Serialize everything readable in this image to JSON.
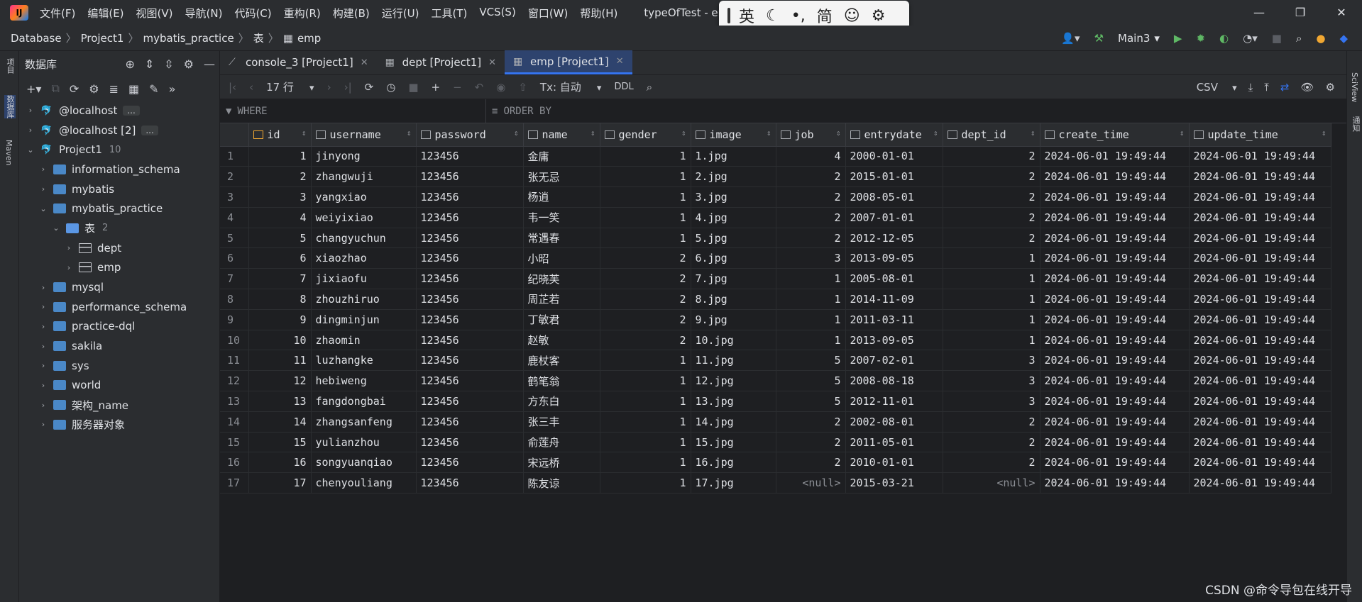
{
  "app": {
    "menu": [
      "文件(F)",
      "编辑(E)",
      "视图(V)",
      "导航(N)",
      "代码(C)",
      "重构(R)",
      "构建(B)",
      "运行(U)",
      "工具(T)",
      "VCS(S)",
      "窗口(W)",
      "帮助(H)"
    ],
    "title": "typeOfTest - emp [P"
  },
  "ime": {
    "lang": "英",
    "punct": "•,",
    "mode": "简"
  },
  "breadcrumb": [
    "Database",
    "Project1",
    "mybatis_practice",
    "表",
    "emp"
  ],
  "run_config": "Main3",
  "left_strip": [
    "项目",
    "数据库",
    "Maven"
  ],
  "right_strip": [
    "SciView",
    "通知"
  ],
  "db_panel": {
    "title": "数据库",
    "tree": [
      {
        "label": "@localhost",
        "level": 0,
        "chev": "›",
        "icon": "mysql",
        "dots": "..."
      },
      {
        "label": "@localhost [2]",
        "level": 0,
        "chev": "›",
        "icon": "mysql",
        "dots": "..."
      },
      {
        "label": "Project1",
        "level": 0,
        "chev": "⌄",
        "icon": "mysql",
        "badge": "10"
      },
      {
        "label": "information_schema",
        "level": 1,
        "chev": "›",
        "icon": "db"
      },
      {
        "label": "mybatis",
        "level": 1,
        "chev": "›",
        "icon": "db"
      },
      {
        "label": "mybatis_practice",
        "level": 1,
        "chev": "⌄",
        "icon": "db"
      },
      {
        "label": "表",
        "level": 2,
        "chev": "⌄",
        "icon": "folder",
        "badge": "2"
      },
      {
        "label": "dept",
        "level": 3,
        "chev": "›",
        "icon": "table"
      },
      {
        "label": "emp",
        "level": 3,
        "chev": "›",
        "icon": "table"
      },
      {
        "label": "mysql",
        "level": 1,
        "chev": "›",
        "icon": "db"
      },
      {
        "label": "performance_schema",
        "level": 1,
        "chev": "›",
        "icon": "db"
      },
      {
        "label": "practice-dql",
        "level": 1,
        "chev": "›",
        "icon": "db"
      },
      {
        "label": "sakila",
        "level": 1,
        "chev": "›",
        "icon": "db"
      },
      {
        "label": "sys",
        "level": 1,
        "chev": "›",
        "icon": "db"
      },
      {
        "label": "world",
        "level": 1,
        "chev": "›",
        "icon": "db"
      },
      {
        "label": "架构_name",
        "level": 1,
        "chev": "›",
        "icon": "db"
      },
      {
        "label": "服务器对象",
        "level": 1,
        "chev": "›",
        "icon": "db"
      }
    ]
  },
  "tabs": [
    {
      "label": "console_3 [Project1]",
      "active": false
    },
    {
      "label": "dept [Project1]",
      "active": false
    },
    {
      "label": "emp [Project1]",
      "active": true
    }
  ],
  "grid_toolbar": {
    "rows": "17 行",
    "tx": "Tx: 自动",
    "ddl": "DDL",
    "format": "CSV"
  },
  "filter": {
    "where": "WHERE",
    "order": "ORDER BY"
  },
  "table": {
    "columns": [
      "id",
      "username",
      "password",
      "name",
      "gender",
      "image",
      "job",
      "entrydate",
      "dept_id",
      "create_time",
      "update_time"
    ],
    "rows": [
      [
        "1",
        "1",
        "jinyong",
        "123456",
        "金庸",
        "1",
        "1.jpg",
        "4",
        "2000-01-01",
        "2",
        "2024-06-01 19:49:44",
        "2024-06-01 19:49:44"
      ],
      [
        "2",
        "2",
        "zhangwuji",
        "123456",
        "张无忌",
        "1",
        "2.jpg",
        "2",
        "2015-01-01",
        "2",
        "2024-06-01 19:49:44",
        "2024-06-01 19:49:44"
      ],
      [
        "3",
        "3",
        "yangxiao",
        "123456",
        "杨逍",
        "1",
        "3.jpg",
        "2",
        "2008-05-01",
        "2",
        "2024-06-01 19:49:44",
        "2024-06-01 19:49:44"
      ],
      [
        "4",
        "4",
        "weiyixiao",
        "123456",
        "韦一笑",
        "1",
        "4.jpg",
        "2",
        "2007-01-01",
        "2",
        "2024-06-01 19:49:44",
        "2024-06-01 19:49:44"
      ],
      [
        "5",
        "5",
        "changyuchun",
        "123456",
        "常遇春",
        "1",
        "5.jpg",
        "2",
        "2012-12-05",
        "2",
        "2024-06-01 19:49:44",
        "2024-06-01 19:49:44"
      ],
      [
        "6",
        "6",
        "xiaozhao",
        "123456",
        "小昭",
        "2",
        "6.jpg",
        "3",
        "2013-09-05",
        "1",
        "2024-06-01 19:49:44",
        "2024-06-01 19:49:44"
      ],
      [
        "7",
        "7",
        "jixiaofu",
        "123456",
        "纪晓芙",
        "2",
        "7.jpg",
        "1",
        "2005-08-01",
        "1",
        "2024-06-01 19:49:44",
        "2024-06-01 19:49:44"
      ],
      [
        "8",
        "8",
        "zhouzhiruo",
        "123456",
        "周芷若",
        "2",
        "8.jpg",
        "1",
        "2014-11-09",
        "1",
        "2024-06-01 19:49:44",
        "2024-06-01 19:49:44"
      ],
      [
        "9",
        "9",
        "dingminjun",
        "123456",
        "丁敏君",
        "2",
        "9.jpg",
        "1",
        "2011-03-11",
        "1",
        "2024-06-01 19:49:44",
        "2024-06-01 19:49:44"
      ],
      [
        "10",
        "10",
        "zhaomin",
        "123456",
        "赵敏",
        "2",
        "10.jpg",
        "1",
        "2013-09-05",
        "1",
        "2024-06-01 19:49:44",
        "2024-06-01 19:49:44"
      ],
      [
        "11",
        "11",
        "luzhangke",
        "123456",
        "鹿杖客",
        "1",
        "11.jpg",
        "5",
        "2007-02-01",
        "3",
        "2024-06-01 19:49:44",
        "2024-06-01 19:49:44"
      ],
      [
        "12",
        "12",
        "hebiweng",
        "123456",
        "鹤笔翁",
        "1",
        "12.jpg",
        "5",
        "2008-08-18",
        "3",
        "2024-06-01 19:49:44",
        "2024-06-01 19:49:44"
      ],
      [
        "13",
        "13",
        "fangdongbai",
        "123456",
        "方东白",
        "1",
        "13.jpg",
        "5",
        "2012-11-01",
        "3",
        "2024-06-01 19:49:44",
        "2024-06-01 19:49:44"
      ],
      [
        "14",
        "14",
        "zhangsanfeng",
        "123456",
        "张三丰",
        "1",
        "14.jpg",
        "2",
        "2002-08-01",
        "2",
        "2024-06-01 19:49:44",
        "2024-06-01 19:49:44"
      ],
      [
        "15",
        "15",
        "yulianzhou",
        "123456",
        "俞莲舟",
        "1",
        "15.jpg",
        "2",
        "2011-05-01",
        "2",
        "2024-06-01 19:49:44",
        "2024-06-01 19:49:44"
      ],
      [
        "16",
        "16",
        "songyuanqiao",
        "123456",
        "宋远桥",
        "1",
        "16.jpg",
        "2",
        "2010-01-01",
        "2",
        "2024-06-01 19:49:44",
        "2024-06-01 19:49:44"
      ],
      [
        "17",
        "17",
        "chenyouliang",
        "123456",
        "陈友谅",
        "1",
        "17.jpg",
        "<null>",
        "2015-03-21",
        "<null>",
        "2024-06-01 19:49:44",
        "2024-06-01 19:49:44"
      ]
    ]
  },
  "watermark": "CSDN @命令导包在线开导"
}
